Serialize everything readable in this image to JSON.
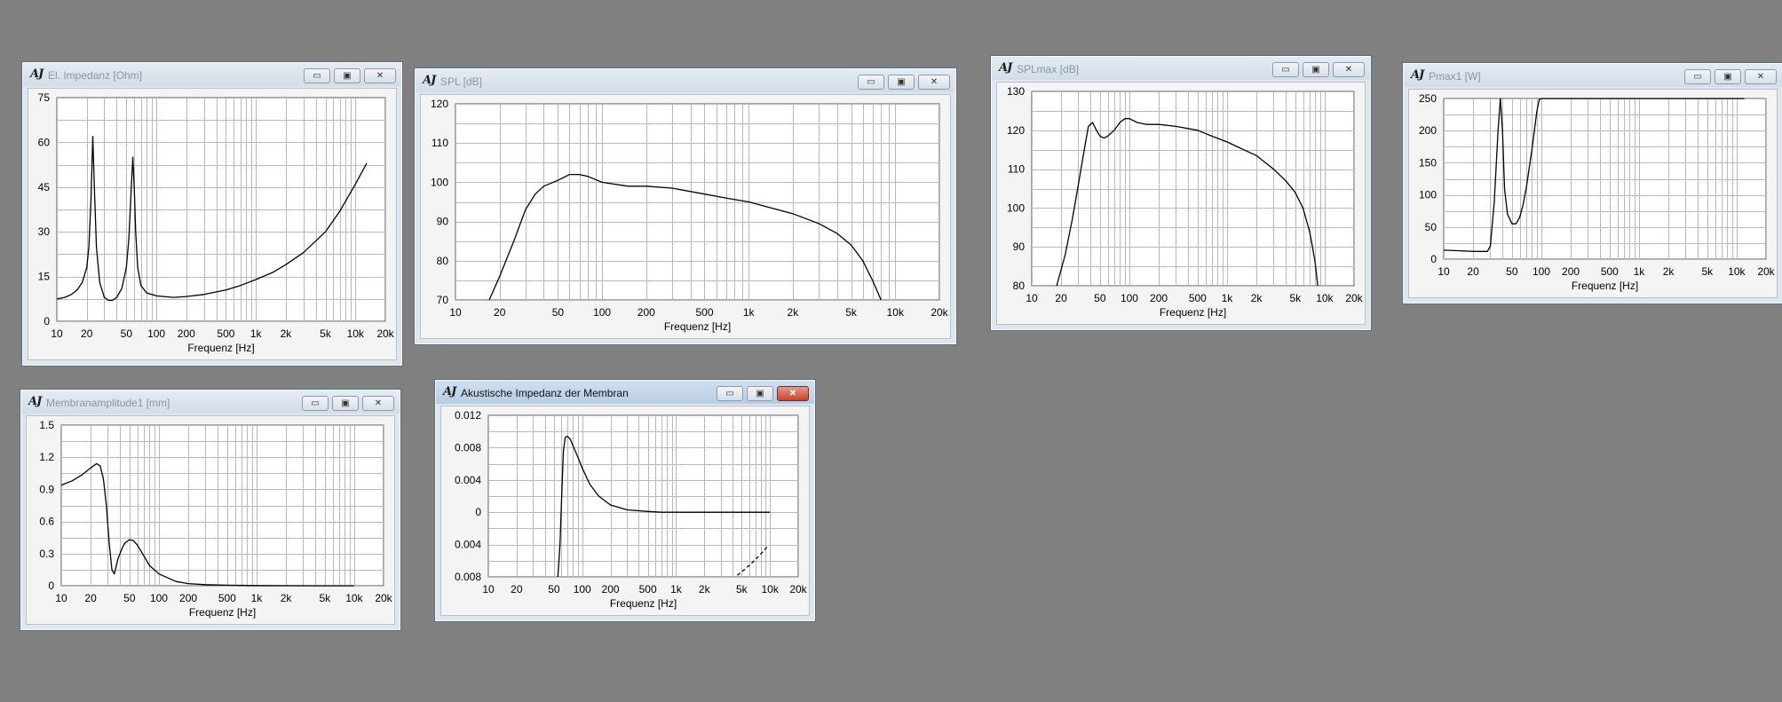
{
  "logo_text": "AJ",
  "buttons": {
    "minimize": "▭",
    "maximize": "▣",
    "close": "✕"
  },
  "colors": {
    "desktop": "#808080",
    "curve": "#000000",
    "grid": "#b8b8b8",
    "plot_bg": "#ffffff"
  },
  "windows": [
    {
      "id": "impedance",
      "title": "El. Impedanz [Ohm]",
      "active": false,
      "chart_data": {
        "type": "line",
        "xscale": "log",
        "xlim": [
          10,
          20000
        ],
        "ylim": [
          0,
          75
        ],
        "xticks": [
          "10",
          "20",
          "50",
          "100",
          "200",
          "500",
          "1k",
          "2k",
          "5k",
          "10k",
          "20k"
        ],
        "yticks": [
          "75",
          "60",
          "45",
          "30",
          "15",
          "0"
        ],
        "xlabel": "Frequenz [Hz]",
        "series": [
          {
            "x": [
              10,
              12,
              14,
              16,
              18,
              20,
              21,
              22,
              23,
              24,
              25,
              27,
              30,
              33,
              36,
              40,
              45,
              50,
              53,
              56,
              58,
              60,
              62,
              65,
              70,
              80,
              90,
              100,
              150,
              200,
              300,
              500,
              700,
              1000,
              1500,
              2000,
              3000,
              5000,
              7000,
              10000,
              13000
            ],
            "y": [
              7.5,
              8,
              9,
              10.5,
              13,
              18,
              25,
              40,
              62,
              42,
              25,
              13,
              8,
              7,
              7,
              8,
              11,
              18,
              28,
              45,
              55,
              45,
              30,
              18,
              12,
              9.5,
              9,
              8.5,
              8,
              8.3,
              9,
              10.5,
              12,
              14,
              16.5,
              19,
              23,
              30,
              37,
              46,
              53
            ]
          }
        ]
      }
    },
    {
      "id": "spl",
      "title": "SPL [dB]",
      "active": false,
      "chart_data": {
        "type": "line",
        "xscale": "log",
        "xlim": [
          10,
          20000
        ],
        "ylim": [
          70,
          120
        ],
        "xticks": [
          "10",
          "20",
          "50",
          "100",
          "200",
          "500",
          "1k",
          "2k",
          "5k",
          "10k",
          "20k"
        ],
        "yticks": [
          "120",
          "110",
          "100",
          "90",
          "80",
          "70"
        ],
        "xlabel": "Frequenz [Hz]",
        "series": [
          {
            "x": [
              17,
              20,
              25,
              30,
              35,
              40,
              50,
              60,
              70,
              80,
              100,
              150,
              200,
              300,
              500,
              700,
              1000,
              2000,
              3000,
              4000,
              5000,
              6000,
              7000,
              8000
            ],
            "y": [
              70,
              76,
              85,
              93,
              97,
              99,
              100.5,
              102,
              102,
              101.5,
              100,
              99,
              99,
              98.5,
              97,
              96,
              95,
              92,
              89.5,
              87,
              84,
              80,
              75,
              70
            ]
          }
        ]
      }
    },
    {
      "id": "splmax",
      "title": "SPLmax [dB]",
      "active": false,
      "chart_data": {
        "type": "line",
        "xscale": "log",
        "xlim": [
          10,
          20000
        ],
        "ylim": [
          80,
          130
        ],
        "xticks": [
          "10",
          "20",
          "50",
          "100",
          "200",
          "500",
          "1k",
          "2k",
          "5k",
          "10k",
          "20k"
        ],
        "yticks": [
          "130",
          "120",
          "110",
          "100",
          "90",
          "80"
        ],
        "xlabel": "Frequenz [Hz]",
        "series": [
          {
            "x": [
              18,
              22,
              26,
              30,
              34,
              38,
              42,
              46,
              50,
              55,
              60,
              70,
              80,
              90,
              100,
              120,
              150,
              200,
              300,
              500,
              700,
              1000,
              2000,
              3000,
              4000,
              5000,
              6000,
              7000,
              7500,
              8000,
              8500
            ],
            "y": [
              80,
              88,
              97,
              106,
              114,
              121,
              122,
              120,
              118.5,
              118,
              118.5,
              120,
              122,
              123,
              123,
              122,
              121.5,
              121.5,
              121,
              120,
              118.5,
              117,
              113.5,
              110,
              107,
              104,
              100,
              94,
              90,
              86,
              80
            ]
          }
        ]
      }
    },
    {
      "id": "pmax",
      "title": "Pmax1 [W]",
      "active": false,
      "chart_data": {
        "type": "line",
        "xscale": "log",
        "xlim": [
          10,
          20000
        ],
        "ylim": [
          0,
          250
        ],
        "xticks": [
          "10",
          "20",
          "50",
          "100",
          "200",
          "500",
          "1k",
          "2k",
          "5k",
          "10k",
          "20k"
        ],
        "yticks": [
          "250",
          "200",
          "150",
          "100",
          "50",
          "0"
        ],
        "xlabel": "Frequenz [Hz]",
        "series": [
          {
            "x": [
              10,
              15,
              20,
              25,
              28,
              30,
              33,
              36,
              38,
              40,
              42,
              45,
              50,
              55,
              60,
              65,
              70,
              80,
              90,
              95,
              100,
              12000
            ],
            "y": [
              14,
              13,
              12,
              12,
              12,
              20,
              90,
              200,
              250,
              200,
              110,
              70,
              55,
              55,
              65,
              85,
              110,
              170,
              230,
              248,
              250,
              250
            ]
          }
        ]
      }
    },
    {
      "id": "excursion",
      "title": "Membranamplitude1 [mm]",
      "active": false,
      "chart_data": {
        "type": "line",
        "xscale": "log",
        "xlim": [
          10,
          20000
        ],
        "ylim": [
          0,
          1.5
        ],
        "xticks": [
          "10",
          "20",
          "50",
          "100",
          "200",
          "500",
          "1k",
          "2k",
          "5k",
          "10k",
          "20k"
        ],
        "yticks": [
          "1.5",
          "1.2",
          "0.9",
          "0.6",
          "0.3",
          "0"
        ],
        "xlabel": "Frequenz [Hz]",
        "series": [
          {
            "x": [
              10,
              13,
              16,
              20,
              23,
              25,
              27,
              29,
              31,
              33,
              35,
              38,
              42,
              45,
              50,
              55,
              60,
              70,
              80,
              100,
              150,
              200,
              300,
              500,
              1000,
              2000,
              5000,
              10000
            ],
            "y": [
              0.94,
              0.98,
              1.03,
              1.1,
              1.14,
              1.12,
              1.0,
              0.75,
              0.4,
              0.15,
              0.11,
              0.25,
              0.35,
              0.4,
              0.43,
              0.42,
              0.38,
              0.28,
              0.19,
              0.11,
              0.04,
              0.02,
              0.01,
              0.005,
              0.002,
              0.001,
              0,
              0
            ]
          }
        ]
      }
    },
    {
      "id": "acoustic",
      "title": "Akustische Impedanz der Membran",
      "active": true,
      "chart_data": {
        "type": "line",
        "xscale": "log",
        "xlim": [
          10,
          20000
        ],
        "ylim": [
          -0.008,
          0.012
        ],
        "xticks": [
          "10",
          "20",
          "50",
          "100",
          "200",
          "500",
          "1k",
          "2k",
          "5k",
          "10k",
          "20k"
        ],
        "yticks": [
          "0.012",
          "0.008",
          "0.004",
          "0",
          "0.004",
          "0.008"
        ],
        "xlabel": "Frequenz [Hz]",
        "series": [
          {
            "style": "solid",
            "x": [
              55,
              58,
              60,
              63,
              66,
              70,
              75,
              80,
              90,
              100,
              120,
              150,
              200,
              300,
              500,
              700,
              1000,
              2000,
              5000,
              10000
            ],
            "y": [
              -0.008,
              -0.004,
              0.001,
              0.0075,
              0.0093,
              0.0094,
              0.009,
              0.0082,
              0.0068,
              0.0055,
              0.0035,
              0.002,
              0.0009,
              0.0003,
              0.0001,
              0,
              0,
              0,
              0,
              0
            ]
          },
          {
            "style": "dashed",
            "x": [
              4500,
              6000,
              7500,
              9500
            ],
            "y": [
              -0.0078,
              -0.0066,
              -0.0055,
              -0.0042
            ]
          }
        ]
      }
    }
  ]
}
